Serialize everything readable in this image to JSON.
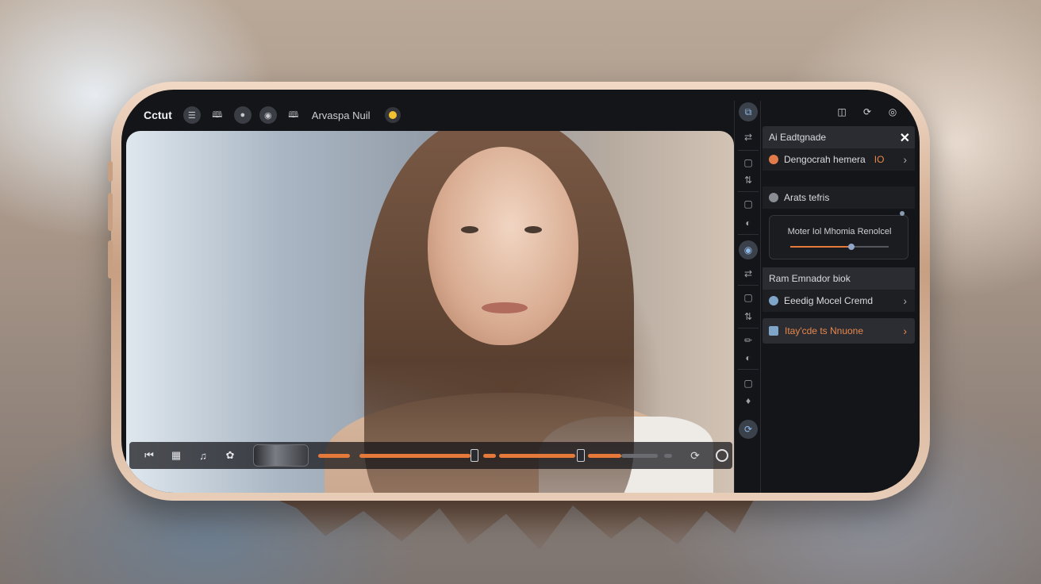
{
  "toolbar": {
    "brand": "Cctut",
    "label": "Arvaspa Nuil",
    "icons": [
      "layers-icon",
      "book-icon",
      "record-icon",
      "mask-icon",
      "book-icon"
    ]
  },
  "top_right_icons": [
    "database-icon",
    "sync-icon",
    "globe-icon"
  ],
  "panel": {
    "header": "Ai Eadtgnade",
    "rows": [
      {
        "label": "Dengocrah hemera",
        "badge": "IO"
      },
      {
        "label": "Arats tefris"
      }
    ],
    "slider": {
      "label": "Moter Iol Mhomia Renolcel",
      "value": 0.62
    },
    "section": "Ram Emnador biok",
    "row2": {
      "label": "Eeedig  Mocel Cremd"
    },
    "cta": {
      "label": "Itay'cde ts Nnuone"
    }
  },
  "timeline": {
    "icons": [
      "skip-icon",
      "grid-icon",
      "music-icon",
      "effect-icon"
    ],
    "right_icons": [
      "speed-icon",
      "record-circle-icon"
    ]
  },
  "colors": {
    "accent": "#e5793a",
    "panel_bg": "#1e1f23",
    "screen_bg": "#141518",
    "status_dot": "#f2c230"
  }
}
